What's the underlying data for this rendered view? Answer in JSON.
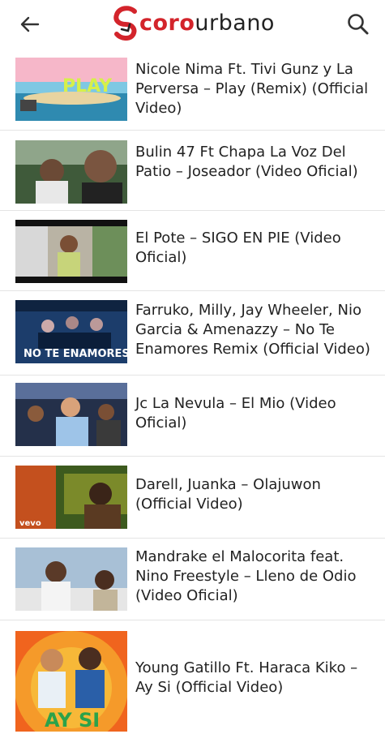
{
  "header": {
    "logo_part1": "coro",
    "logo_part2": "urbano",
    "back_icon": "arrow-left-icon",
    "search_icon": "search-icon",
    "brand_color": "#d3242b"
  },
  "videos": [
    {
      "title": "Nicole Nima Ft. Tivi Gunz y La Perversa – Play (Remix) (Official Video)",
      "thumb_overlay": "PLAY"
    },
    {
      "title": "Bulin 47 Ft Chapa La Voz Del Patio – Joseador (Video Oficial)",
      "thumb_overlay": ""
    },
    {
      "title": "El Pote – SIGO EN PIE (Video Oficial)",
      "thumb_overlay": ""
    },
    {
      "title": "Farruko, Milly, Jay Wheeler, Nio Garcia & Amenazzy – No Te Enamores Remix (Official Video)",
      "thumb_overlay": "NO TE ENAMORES"
    },
    {
      "title": "Jc La Nevula – El Mio (Video Oficial)",
      "thumb_overlay": ""
    },
    {
      "title": "Darell, Juanka – Olajuwon (Official Video)",
      "thumb_overlay": "vevo"
    },
    {
      "title": "Mandrake el Malocorita feat. Nino Freestyle – Lleno de Odio (Video Oficial)",
      "thumb_overlay": ""
    },
    {
      "title": "Young Gatillo Ft. Haraca Kiko – Ay Si (Official Video)",
      "thumb_overlay": "AY SI"
    }
  ]
}
